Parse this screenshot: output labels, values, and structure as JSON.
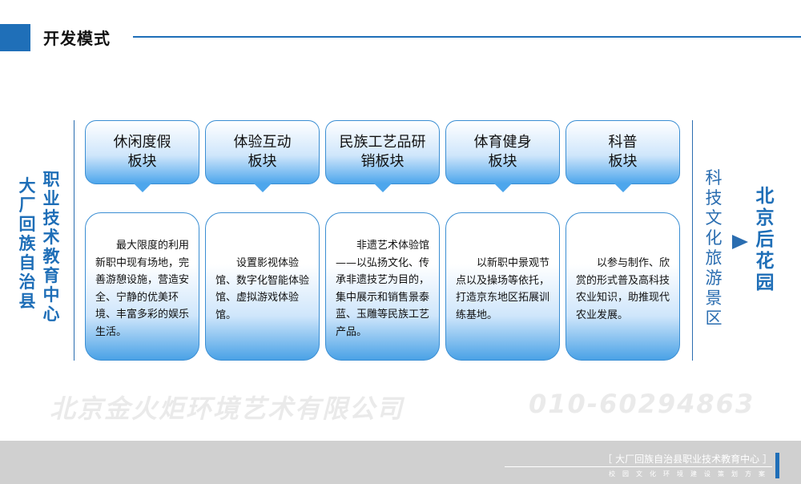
{
  "page_title": "开发模式",
  "left_labels": {
    "school": "职业技术教育中心",
    "county": "大厂回族自治县"
  },
  "right_labels": {
    "zone": "科技文化旅游景区",
    "garden": "北京后花园"
  },
  "modules": [
    {
      "title": "休闲度假\n板块",
      "desc": "最大限度的利用新职中现有场地，完善游憩设施，营造安全、宁静的优美环境、丰富多彩的娱乐生活。"
    },
    {
      "title": "体验互动\n板块",
      "desc": "设置影视体验馆、数字化智能体验馆、虚拟游戏体验馆。"
    },
    {
      "title": "民族工艺品研\n销板块",
      "desc": "非遗艺术体验馆——以弘扬文化、传承非遗技艺为目的，集中展示和销售景泰蓝、玉雕等民族工艺产品。"
    },
    {
      "title": "体育健身\n板块",
      "desc": "以新职中景观节点以及操场等依托，打造京东地区拓展训练基地。"
    },
    {
      "title": "科普\n板块",
      "desc": "以参与制作、欣赏的形式普及高科技农业知识，助推现代农业发展。"
    }
  ],
  "watermark": {
    "company": "北京金火炬环境艺术有限公司",
    "phone": "010-60294863"
  },
  "footer": {
    "name": "［ 大厂回族自治县职业技术教育中心 ］",
    "subtitle": "校园文化环境建设策划方案"
  }
}
